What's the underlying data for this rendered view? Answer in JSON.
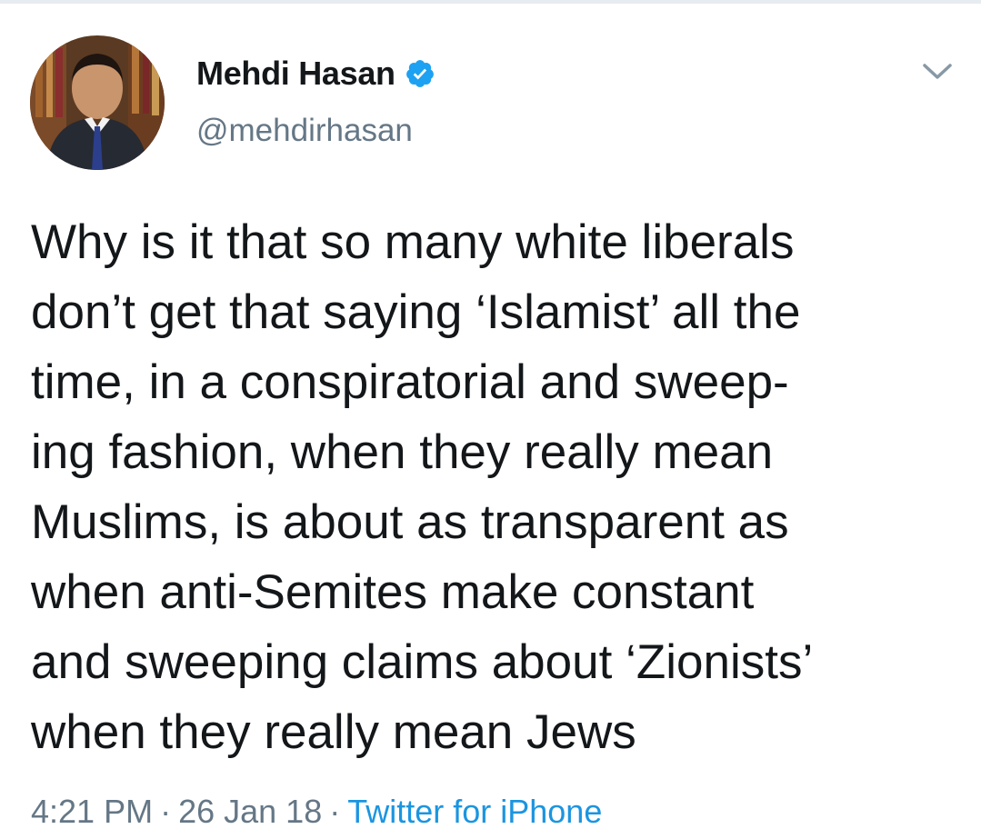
{
  "user": {
    "display_name": "Mehdi Hasan",
    "handle": "@mehdirhasan",
    "verified": true,
    "avatar_icon": "profile-photo"
  },
  "tweet": {
    "text": "Why is it that so many white liberals\ndon’t get that saying ‘Islamist’ all the\ntime, in a conspiratorial and sweep-\ning fashion, when they really mean\nMuslims, is about as transparent as\nwhen anti-Semites make constant\nand sweeping claims about ‘Zionists’\nwhen they really mean Jews",
    "time": "4:21 PM",
    "date": "26 Jan 18",
    "source": "Twitter for iPhone",
    "separator": "·"
  },
  "icons": {
    "verified": "verified-badge-icon",
    "menu": "chevron-down-icon"
  },
  "colors": {
    "text": "#14171a",
    "secondary": "#657786",
    "link": "#1b95e0",
    "verified": "#1da1f2"
  }
}
